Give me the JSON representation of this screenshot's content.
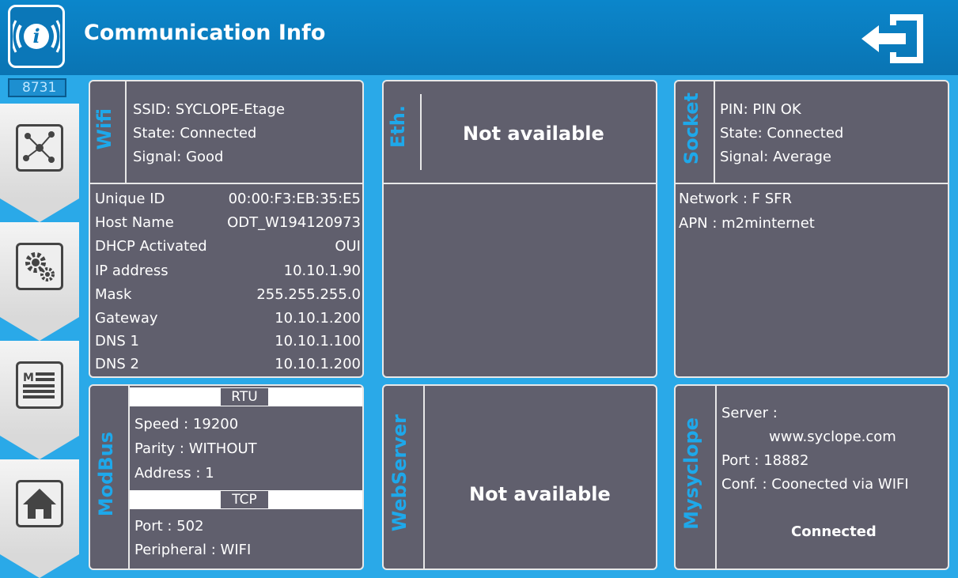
{
  "header": {
    "title": "Communication Info"
  },
  "sidebar": {
    "counter": "8731"
  },
  "wifi": {
    "label": "Wifi",
    "ssid": "SSID: SYCLOPE-Etage",
    "state": "State: Connected",
    "signal": "Signal: Good",
    "rows": [
      {
        "k": "Unique ID",
        "v": "00:00:F3:EB:35:E5"
      },
      {
        "k": "Host Name",
        "v": "ODT_W194120973"
      },
      {
        "k": "DHCP Activated",
        "v": "OUI"
      },
      {
        "k": "IP address",
        "v": "10.10.1.90"
      },
      {
        "k": "Mask",
        "v": "255.255.255.0"
      },
      {
        "k": "Gateway",
        "v": "10.10.1.200"
      },
      {
        "k": "DNS 1",
        "v": "10.10.1.100"
      },
      {
        "k": "DNS 2",
        "v": "10.10.1.200"
      }
    ]
  },
  "eth": {
    "label": "Eth.",
    "status": "Not available"
  },
  "socket": {
    "label": "Socket",
    "pin": "PIN: PIN OK",
    "state": "State: Connected",
    "signal": "Signal: Average",
    "network": "Network : F SFR",
    "apn": "APN : m2minternet"
  },
  "modbus": {
    "label": "ModBus",
    "rtu_label": "RTU",
    "speed": "Speed : 19200",
    "parity": "Parity : WITHOUT",
    "address": "Address : 1",
    "tcp_label": "TCP",
    "port": "Port : 502",
    "peripheral": "Peripheral : WIFI"
  },
  "webserver": {
    "label": "WebServer",
    "status": "Not available"
  },
  "mysyclope": {
    "label": "Mysyclope",
    "server_label": "Server :",
    "server": "www.syclope.com",
    "port": "Port : 18882",
    "conf": "Conf. : Coonected via WIFI",
    "status": "Connected"
  }
}
